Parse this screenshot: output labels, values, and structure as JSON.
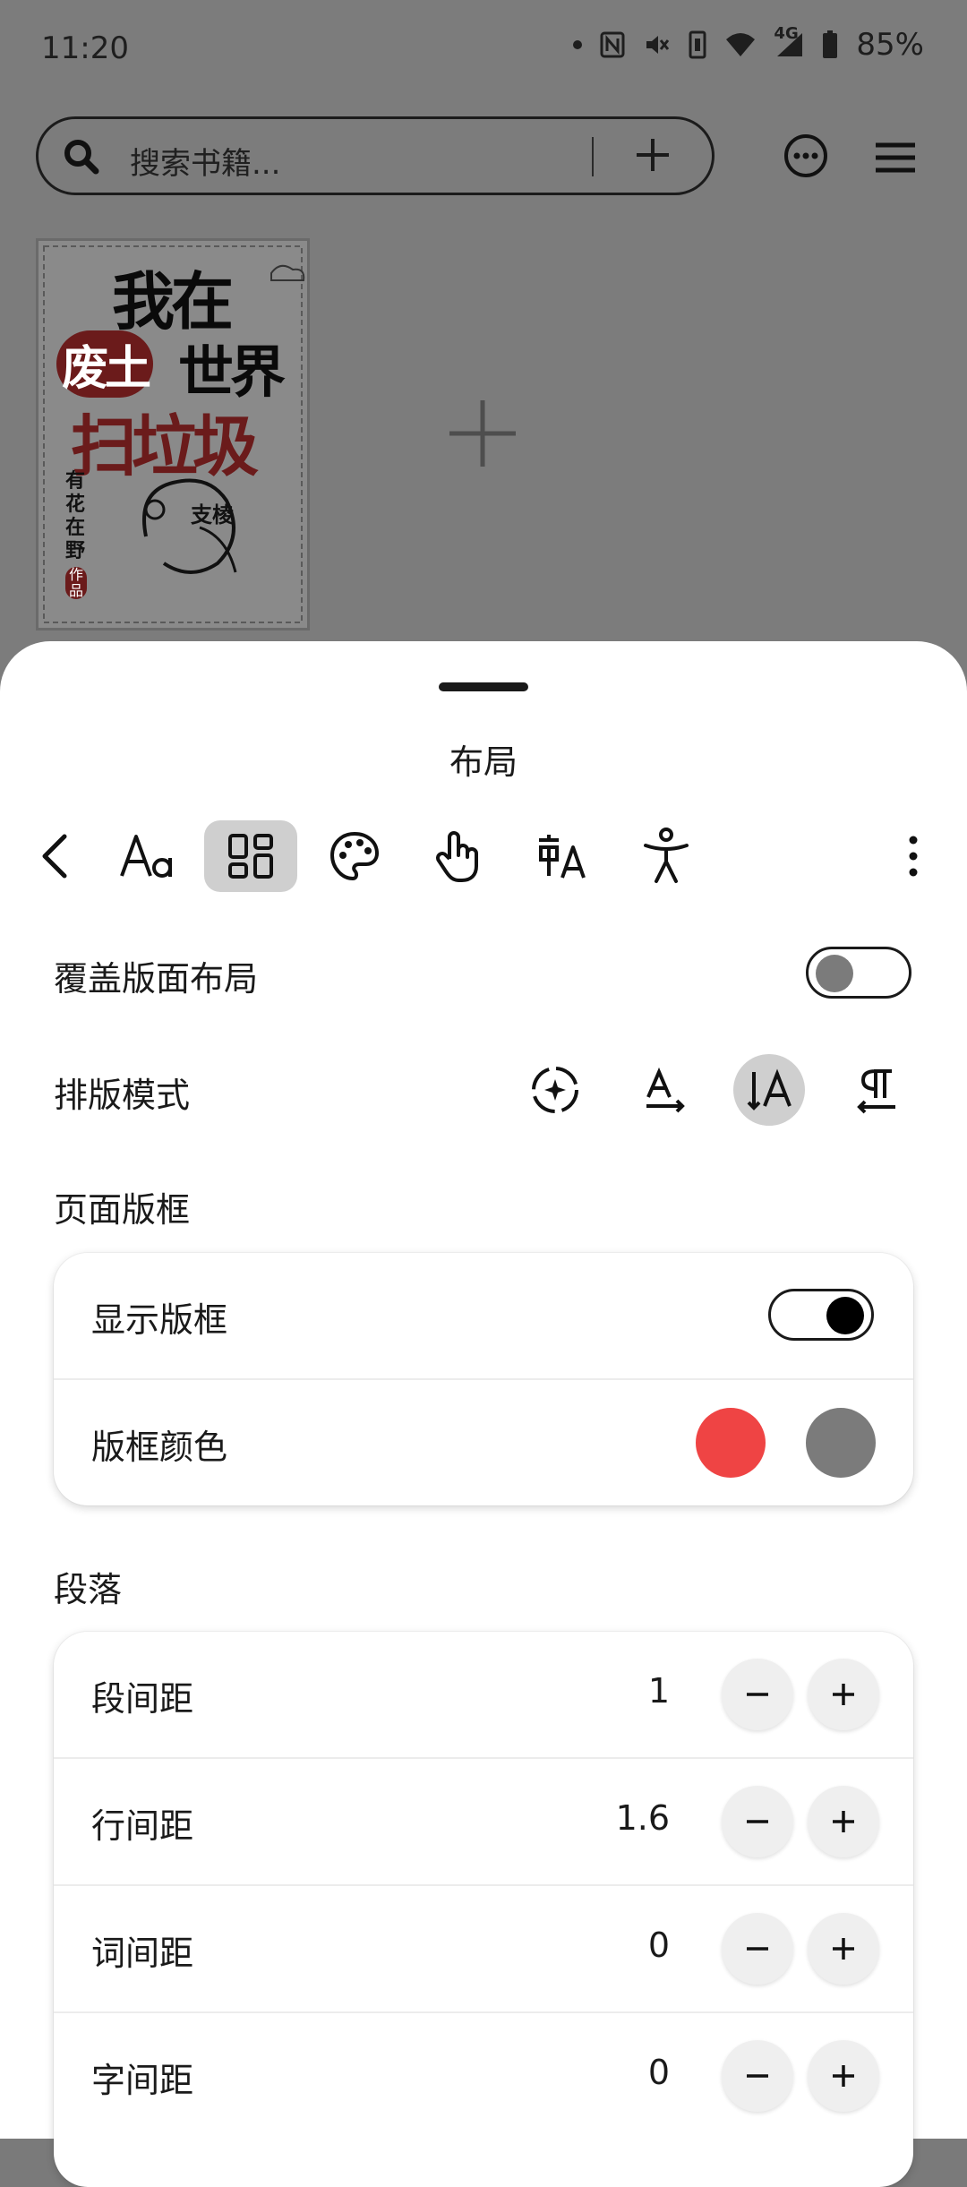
{
  "status_bar": {
    "time": "11:20",
    "network": "4G",
    "battery": "85%",
    "icons": [
      "dot-icon",
      "nfc-icon",
      "mute-icon",
      "vibrate-icon",
      "wifi-icon",
      "signal-icon",
      "battery-icon"
    ]
  },
  "library": {
    "search_placeholder": "搜索书籍...",
    "book_cover_text": {
      "title_line1": "我在",
      "title_tag": "废土",
      "title_line2": "世界",
      "title_line3": "扫垃圾",
      "author": "有花在野",
      "author_suffix": "作品",
      "badge": "支棱"
    }
  },
  "sheet": {
    "title": "布局",
    "toolbar_icons": [
      "back-icon",
      "font-icon",
      "layout-icon",
      "palette-icon",
      "touch-icon",
      "translate-icon",
      "accessibility-icon",
      "more-vertical-icon"
    ],
    "active_tab": "layout",
    "override_layout": {
      "label": "覆盖版面布局",
      "enabled": false
    },
    "typeset_mode": {
      "label": "排版模式",
      "options": [
        "auto-icon",
        "horizontal-text-icon",
        "vertical-text-icon",
        "rtl-paragraph-icon"
      ],
      "selected": "vertical-text-icon"
    },
    "page_frame": {
      "section_title": "页面版框",
      "show_frame": {
        "label": "显示版框",
        "enabled": true
      },
      "frame_color": {
        "label": "版框颜色",
        "colors": [
          "#ef4444",
          "#7b7b7b"
        ]
      }
    },
    "paragraph": {
      "section_title": "段落",
      "rows": [
        {
          "label": "段间距",
          "value": "1"
        },
        {
          "label": "行间距",
          "value": "1.6"
        },
        {
          "label": "词间距",
          "value": "0"
        },
        {
          "label": "字间距",
          "value": "0"
        }
      ]
    }
  }
}
